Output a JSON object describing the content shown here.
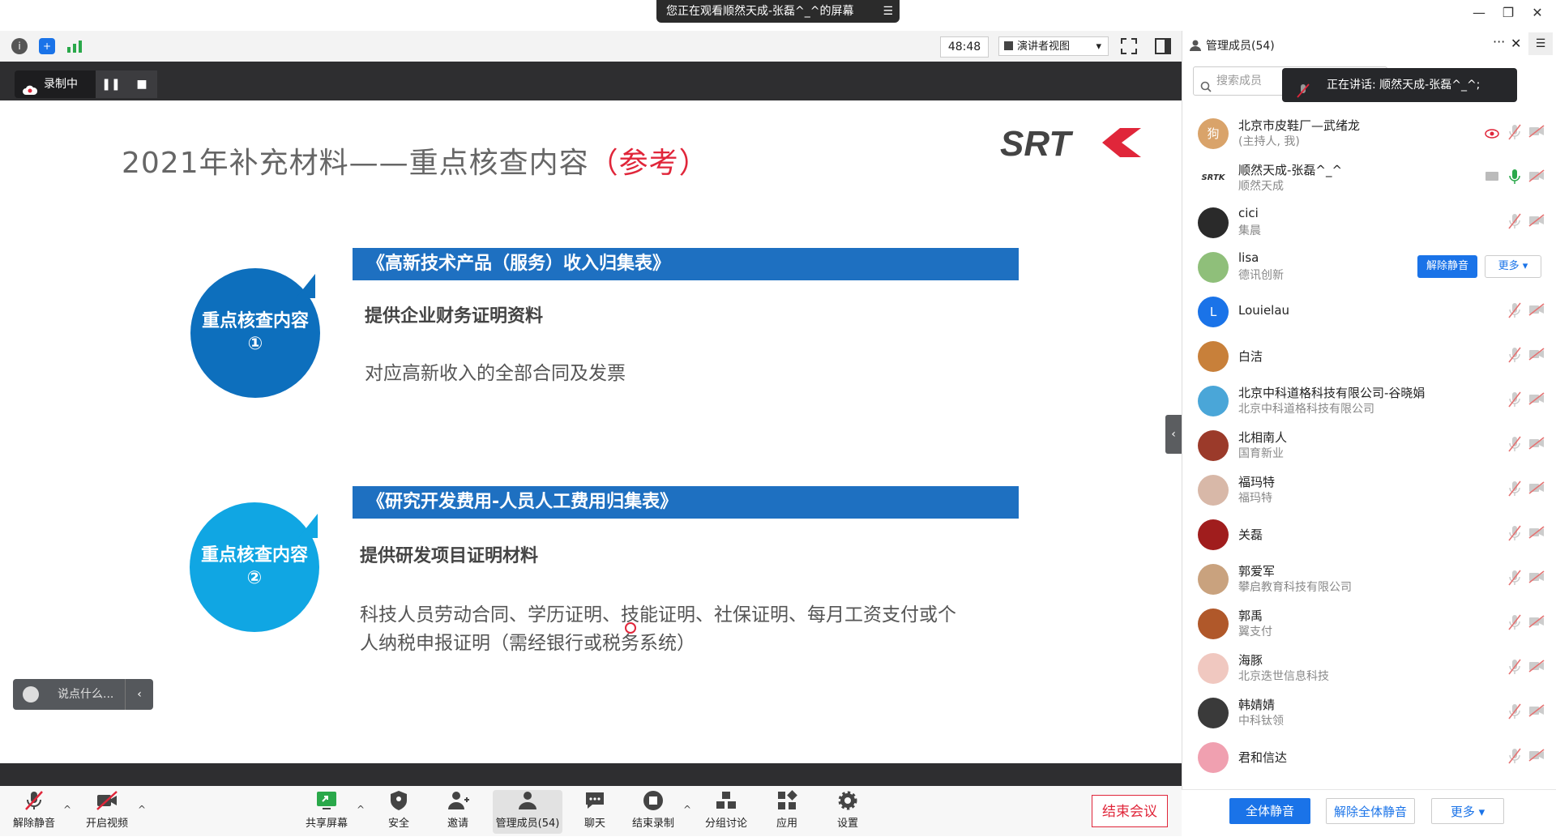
{
  "window": {
    "banner_text": "您正在观看顺然天成-张磊^_^的屏幕",
    "minimize": "—",
    "restore": "❐",
    "close": "✕"
  },
  "top_toolbar": {
    "timer": "48:48",
    "view_label": "演讲者视图",
    "view_caret": "▾"
  },
  "recording": {
    "label": "录制中",
    "pause": "❚❚",
    "stop": "■"
  },
  "slide": {
    "title_main": "2021年补充材料——重点核查内容",
    "title_ref": "（参考）",
    "logo_text": "SRTK",
    "section1": {
      "bubble_line1": "重点核查内容",
      "bubble_line2": "①",
      "bar": "《高新技术产品（服务）收入归集表》",
      "heading": "提供企业财务证明资料",
      "body": "对应高新收入的全部合同及发票"
    },
    "section2": {
      "bubble_line1": "重点核查内容",
      "bubble_line2": "②",
      "bar": "《研究开发费用-人员人工费用归集表》",
      "heading": "提供研发项目证明材料",
      "body_line1": "科技人员劳动合同、学历证明、技能证明、社保证明、每月工资支付或个",
      "body_line2": "人纳税申报证明（需经银行或税务系统）"
    }
  },
  "chat": {
    "placeholder": "说点什么...",
    "chevron": "‹"
  },
  "bottom_toolbar": {
    "unmute": "解除静音",
    "video": "开启视频",
    "share": "共享屏幕",
    "security": "安全",
    "invite": "邀请",
    "members": "管理成员(54)",
    "chat": "聊天",
    "stop_record": "结束录制",
    "breakout": "分组讨论",
    "apps": "应用",
    "settings": "设置",
    "end_meeting": "结束会议",
    "caret": "^"
  },
  "panel": {
    "title": "管理成员(54)",
    "dots": "···",
    "close": "✕",
    "search_placeholder": "搜索成员",
    "speaking": "正在讲话: 顺然天成-张磊^_^;",
    "unmute_btn": "解除静音",
    "more_btn": "更多 ▾",
    "members": [
      {
        "name": "北京市皮鞋厂—武绪龙",
        "sub": "(主持人, 我)",
        "avatar": "狗",
        "color": "#d9a36a"
      },
      {
        "name": "顺然天成-张磊^_^",
        "sub": "顺然天成",
        "avatar": "SRTK",
        "color": "#ffffff"
      },
      {
        "name": "cici",
        "sub": "集晨",
        "avatar": "",
        "color": "#2a2a2a"
      },
      {
        "name": "lisa",
        "sub": "德讯创新",
        "avatar": "",
        "color": "#8fbf7a"
      },
      {
        "name": "Louielau",
        "sub": "",
        "avatar": "L",
        "color": "#1a73e8"
      },
      {
        "name": "白洁",
        "sub": "",
        "avatar": "",
        "color": "#c8803a"
      },
      {
        "name": "北京中科道格科技有限公司-谷晓娟",
        "sub": "北京中科道格科技有限公司",
        "avatar": "",
        "color": "#4aa6d8"
      },
      {
        "name": "北相南人",
        "sub": "国育新业",
        "avatar": "",
        "color": "#9b3a2a"
      },
      {
        "name": "福玛特",
        "sub": "福玛特",
        "avatar": "",
        "color": "#d8b8a8"
      },
      {
        "name": "关磊",
        "sub": "",
        "avatar": "",
        "color": "#a01d1d"
      },
      {
        "name": "郭爱军",
        "sub": "攀启教育科技有限公司",
        "avatar": "",
        "color": "#c9a27e"
      },
      {
        "name": "郭禹",
        "sub": "翼支付",
        "avatar": "",
        "color": "#b0582a"
      },
      {
        "name": "海豚",
        "sub": "北京迭世信息科技",
        "avatar": "",
        "color": "#f0c8c0"
      },
      {
        "name": "韩婧婧",
        "sub": "中科钛领",
        "avatar": "",
        "color": "#3a3a3a"
      },
      {
        "name": "君和信达",
        "sub": "",
        "avatar": "",
        "color": "#f0a0b0"
      }
    ],
    "mute_all": "全体静音",
    "unmute_all": "解除全体静音",
    "more": "更多 ▾"
  }
}
